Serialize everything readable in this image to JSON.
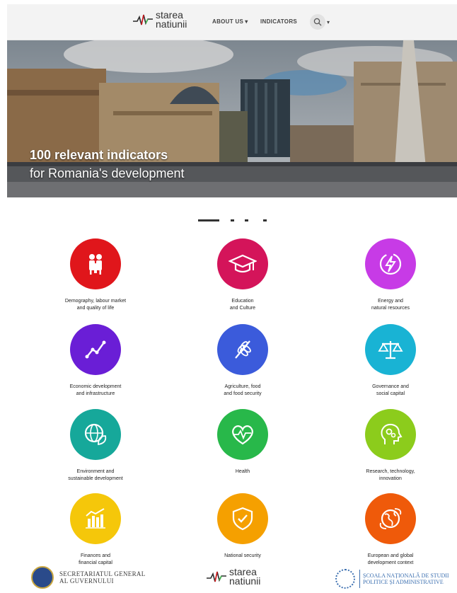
{
  "header": {
    "logo_line1": "starea",
    "logo_line2": "natiunii",
    "nav_about": "ABOUT US",
    "nav_indicators": "INDICATORS"
  },
  "hero": {
    "title": "100 relevant indicators",
    "subtitle": "for Romania's development"
  },
  "categories": [
    {
      "line1": "Demography, labour market",
      "line2": "and quality of life",
      "icon": "family-icon",
      "color": "#e0161b"
    },
    {
      "line1": "Education",
      "line2": "and Culture",
      "icon": "graduation-cap-icon",
      "color": "#d4145a"
    },
    {
      "line1": "Energy and",
      "line2": "natural resources",
      "icon": "energy-icon",
      "color": "#c73be6"
    },
    {
      "line1": "Economic development",
      "line2": "and infrastructure",
      "icon": "growth-chart-icon",
      "color": "#6a1ed6"
    },
    {
      "line1": "Agriculture, food",
      "line2": "and food security",
      "icon": "wheat-icon",
      "color": "#3b5bdb"
    },
    {
      "line1": "Governance and",
      "line2": "social capital",
      "icon": "scales-icon",
      "color": "#19b3d4"
    },
    {
      "line1": "Environment and",
      "line2": "sustainable development",
      "icon": "globe-leaf-icon",
      "color": "#16a89a"
    },
    {
      "line1": "Health",
      "line2": "",
      "icon": "heart-pulse-icon",
      "color": "#28b84a"
    },
    {
      "line1": "Research, technology,",
      "line2": "innovation",
      "icon": "brain-gears-icon",
      "color": "#8ccc1c"
    },
    {
      "line1": "Finances and",
      "line2": "financial capital",
      "icon": "finance-chart-icon",
      "color": "#f5c70a"
    },
    {
      "line1": "National security",
      "line2": "",
      "icon": "shield-check-icon",
      "color": "#f5a000"
    },
    {
      "line1": "European and global",
      "line2": "development context",
      "icon": "globe-icon",
      "color": "#ef5a0a"
    }
  ],
  "footer": {
    "sgg_line1": "SECRETARIATUL GENERAL",
    "sgg_line2": "AL GUVERNULUI",
    "logo_line1": "starea",
    "logo_line2": "natiunii",
    "snsp_line1": "ȘCOALA NAȚIONALĂ DE STUDII",
    "snsp_line2": "POLITICE ȘI ADMINISTRATIVE"
  }
}
